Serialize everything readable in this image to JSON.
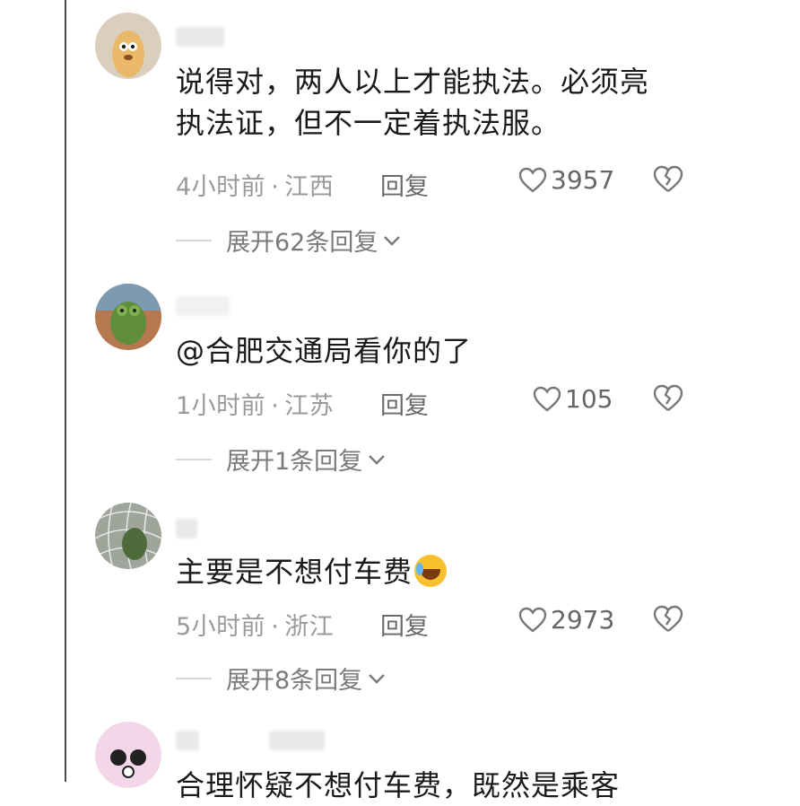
{
  "comments": [
    {
      "text_line1": "说得对，两人以上才能执法。必须亮",
      "text_line2": "执法证，但不一定着执法服。",
      "time": "4小时前",
      "location": "江西",
      "reply_label": "回复",
      "likes": "3957",
      "expand_label": "展开62条回复"
    },
    {
      "text_line1": "@合肥交通局看你的了",
      "time": "1小时前",
      "location": "江苏",
      "reply_label": "回复",
      "likes": "105",
      "expand_label": "展开1条回复"
    },
    {
      "text_line1": "主要是不想付车费",
      "time": "5小时前",
      "location": "浙江",
      "reply_label": "回复",
      "likes": "2973",
      "expand_label": "展开8条回复"
    },
    {
      "text_line1": "合理怀疑不想付车费，既然是乘客"
    }
  ],
  "meta_separator": "·",
  "icons": {
    "like": "heart-outline-icon",
    "dislike": "broken-heart-icon",
    "expand": "chevron-down-icon",
    "emoji": "laughing-crying-emoji"
  },
  "colors": {
    "text": "#1a1a1a",
    "meta": "#9a9a9a",
    "background": "#ffffff"
  }
}
